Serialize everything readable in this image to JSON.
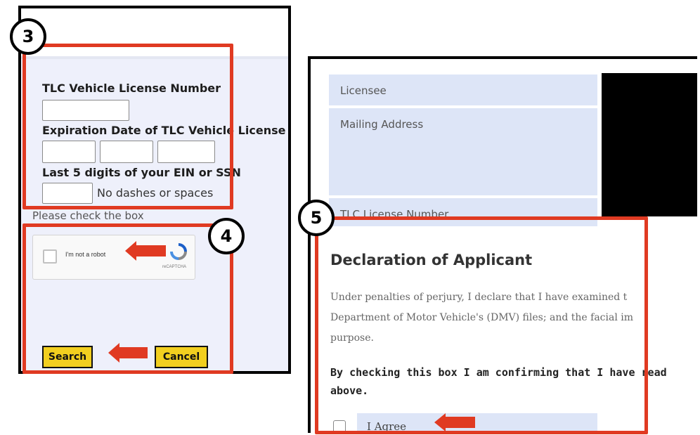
{
  "left_panel": {
    "step_badge": "3",
    "vehicle_label": "TLC Vehicle License Number",
    "vehicle_input_value": "",
    "expiration_label": "Expiration Date of TLC Vehicle License",
    "expiration_inputs": [
      "",
      "",
      ""
    ],
    "ein_label": "Last 5 digits of your EIN or SSN",
    "ein_input_value": "",
    "ein_hint": "No dashes or spaces",
    "check_box_instruction": "Please check the box",
    "captcha_badge": "4",
    "captcha_text": "I'm not a robot",
    "captcha_brand": "reCAPTCHA",
    "search_button": "Search",
    "cancel_button": "Cancel"
  },
  "right_panel": {
    "licensee_label": "Licensee",
    "mailing_address_label": "Mailing Address",
    "tlc_license_label": "TLC License Number",
    "step_badge": "5",
    "declaration_title": "Declaration of Applicant",
    "declaration_line1": "Under penalties of perjury, I declare that I have examined t",
    "declaration_line2": "Department of Motor Vehicle's (DMV) files; and the facial im",
    "declaration_line3": "purpose.",
    "confirm_line1": "By checking this box I am confirming that I have read",
    "confirm_line2": "above.",
    "agree_label": "I Agree"
  },
  "colors": {
    "highlight_red": "#e03a22",
    "button_yellow": "#f2cf1f",
    "form_background": "#eef0fb",
    "row_background": "#dde5f7"
  },
  "icons": {
    "pointer_arrow": "arrow-left-icon",
    "captcha_logo": "recaptcha-icon"
  }
}
